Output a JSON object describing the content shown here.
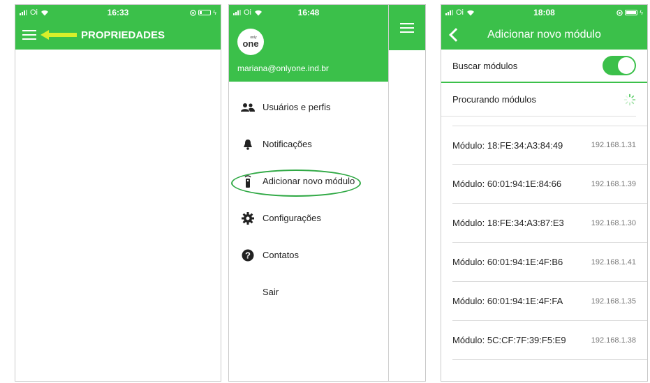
{
  "status1": {
    "carrier": "Oi",
    "time": "16:33"
  },
  "status2": {
    "carrier": "Oi",
    "time": "16:48"
  },
  "status3": {
    "carrier": "Oi",
    "time": "18:08"
  },
  "screen1": {
    "title": "PROPRIEDADES"
  },
  "screen2": {
    "logo_top": "only",
    "logo_main": "one",
    "email": "mariana@onlyone.ind.br",
    "menu": [
      {
        "label": "Usuários e perfis",
        "icon": "users-icon"
      },
      {
        "label": "Notificações",
        "icon": "bell-icon"
      },
      {
        "label": "Adicionar novo módulo",
        "icon": "remote-icon"
      },
      {
        "label": "Configurações",
        "icon": "gear-icon"
      },
      {
        "label": "Contatos",
        "icon": "question-icon"
      },
      {
        "label": "Sair",
        "icon": ""
      }
    ]
  },
  "screen3": {
    "title": "Adicionar novo módulo",
    "search_label": "Buscar módulos",
    "search_on": true,
    "searching_label": "Procurando módulos",
    "modules": [
      {
        "name": "Módulo: 18:FE:34:A3:84:49",
        "ip": "192.168.1.31"
      },
      {
        "name": "Módulo: 60:01:94:1E:84:66",
        "ip": "192.168.1.39"
      },
      {
        "name": "Módulo: 18:FE:34:A3:87:E3",
        "ip": "192.168.1.30"
      },
      {
        "name": "Módulo: 60:01:94:1E:4F:B6",
        "ip": "192.168.1.41"
      },
      {
        "name": "Módulo: 60:01:94:1E:4F:FA",
        "ip": "192.168.1.35"
      },
      {
        "name": "Módulo: 5C:CF:7F:39:F5:E9",
        "ip": "192.168.1.38"
      }
    ]
  },
  "colors": {
    "brand_green": "#3bc04a",
    "highlight": "#2ea843",
    "arrow": "#d8ef2a"
  }
}
